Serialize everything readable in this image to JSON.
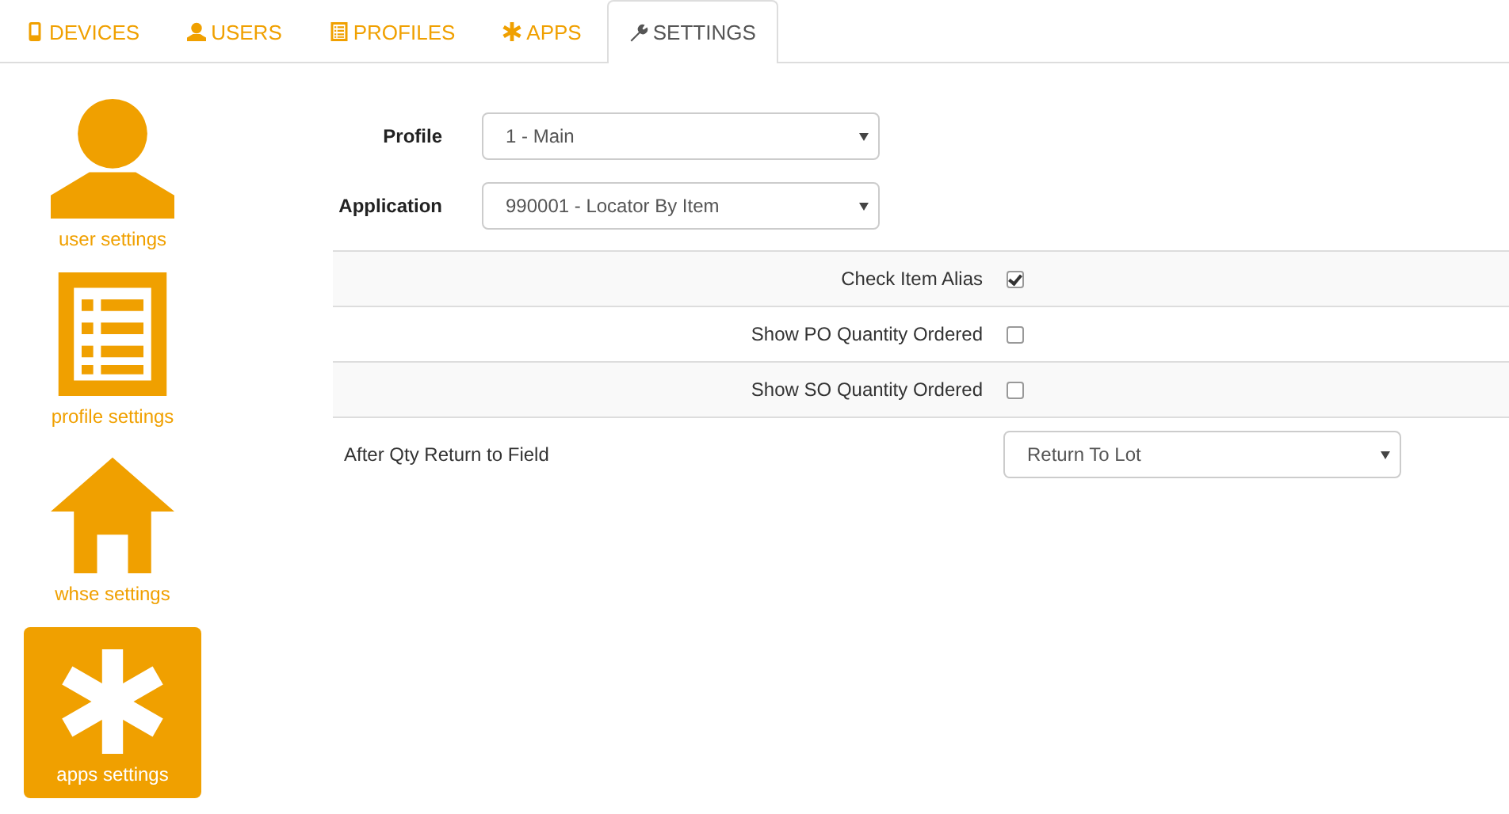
{
  "tabs": [
    {
      "label": "DEVICES",
      "kind": "device",
      "selected": false
    },
    {
      "label": "USERS",
      "kind": "user",
      "selected": false
    },
    {
      "label": "PROFILES",
      "kind": "list",
      "selected": false
    },
    {
      "label": "APPS",
      "kind": "star",
      "selected": false
    },
    {
      "label": "SETTINGS",
      "kind": "wrench",
      "selected": true
    }
  ],
  "sidebar": {
    "items": [
      {
        "label": "user settings",
        "kind": "user",
        "selected": false
      },
      {
        "label": "profile settings",
        "kind": "list",
        "selected": false
      },
      {
        "label": "whse settings",
        "kind": "house",
        "selected": false
      },
      {
        "label": "apps settings",
        "kind": "star",
        "selected": true
      }
    ]
  },
  "form": {
    "fields": [
      {
        "label": "Profile",
        "value": "1 - Main"
      },
      {
        "label": "Application",
        "value": "990001 - Locator By Item"
      }
    ]
  },
  "settings": {
    "rows": [
      {
        "kind": "checkbox",
        "label": "Check Item Alias",
        "checked": true
      },
      {
        "kind": "checkbox",
        "label": "Show PO Quantity Ordered",
        "checked": false
      },
      {
        "kind": "checkbox",
        "label": "Show SO Quantity Ordered",
        "checked": false
      },
      {
        "kind": "select",
        "label": "After Qty Return to Field",
        "value": "Return To Lot"
      }
    ]
  }
}
